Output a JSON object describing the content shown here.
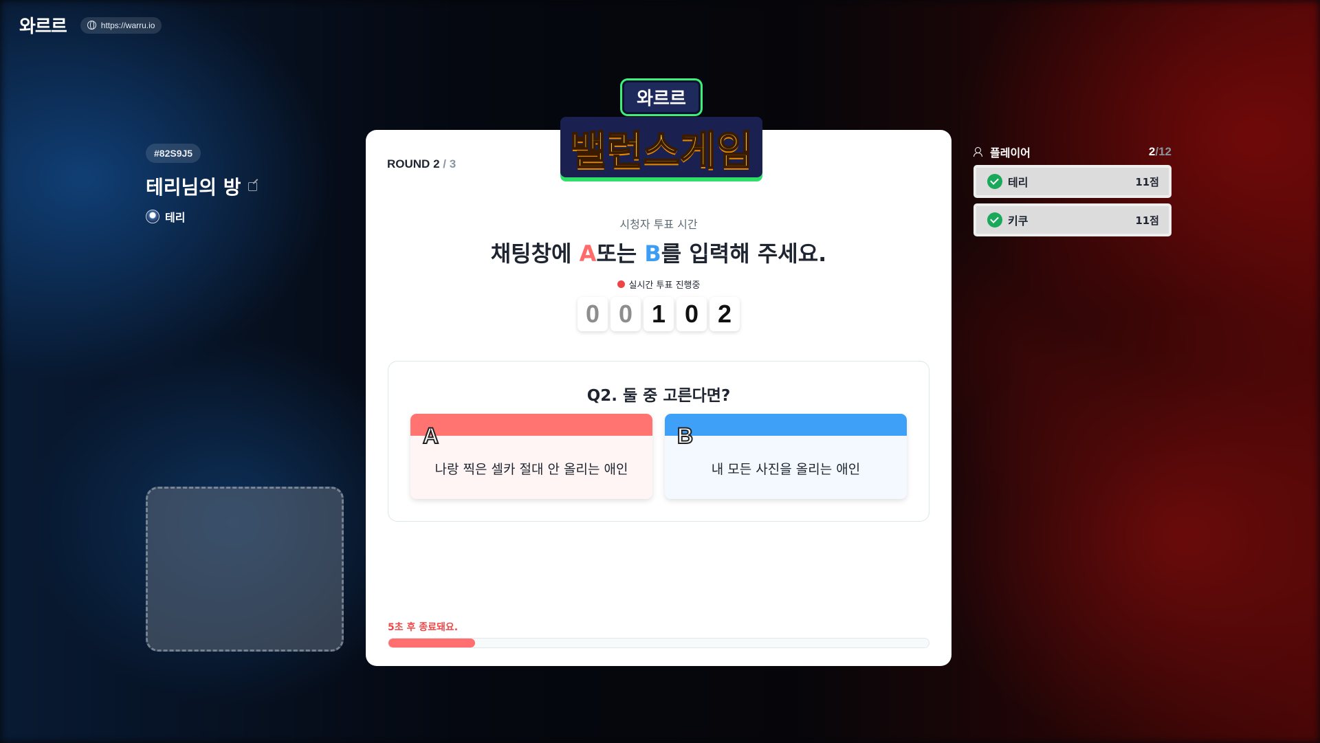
{
  "header": {
    "logo": "와르르",
    "url": "https://warru.io"
  },
  "room": {
    "code": "#82S9J5",
    "title": "테리님의 방",
    "host": "테리"
  },
  "game": {
    "logo_small": "와르르",
    "logo_big": "밸런스게임",
    "round_label": "ROUND",
    "round_current": "2",
    "round_separator": "/",
    "round_total": "3",
    "vote_sub": "시청자 투표 시간",
    "vote_main_prefix": "채팅창에 ",
    "vote_main_a": "A",
    "vote_main_mid": "또는 ",
    "vote_main_b": "B",
    "vote_main_suffix": "를 입력해 주세요.",
    "live_label": "실시간 투표 진행중",
    "counter_digits": [
      "0",
      "0",
      "1",
      "0",
      "2"
    ],
    "question": "Q2. 둘 중 고른다면?",
    "option_a_letter": "A",
    "option_a_text": "나랑 찍은 셀카 절대 안 올리는 애인",
    "option_b_letter": "B",
    "option_b_text": "내 모든 사진을 올리는 애인",
    "end_text": "5초 후 종료돼요.",
    "progress": 0.16
  },
  "players": {
    "title": "플레이어",
    "count_current": "2",
    "count_separator": "/",
    "count_max": "12",
    "list": [
      {
        "name": "테리",
        "score": "11점"
      },
      {
        "name": "키쿠",
        "score": "11점"
      }
    ]
  },
  "colors": {
    "option_a": "#ff7370",
    "option_b": "#3ea0f6",
    "live": "#ef4444",
    "check": "#1aa85a"
  }
}
